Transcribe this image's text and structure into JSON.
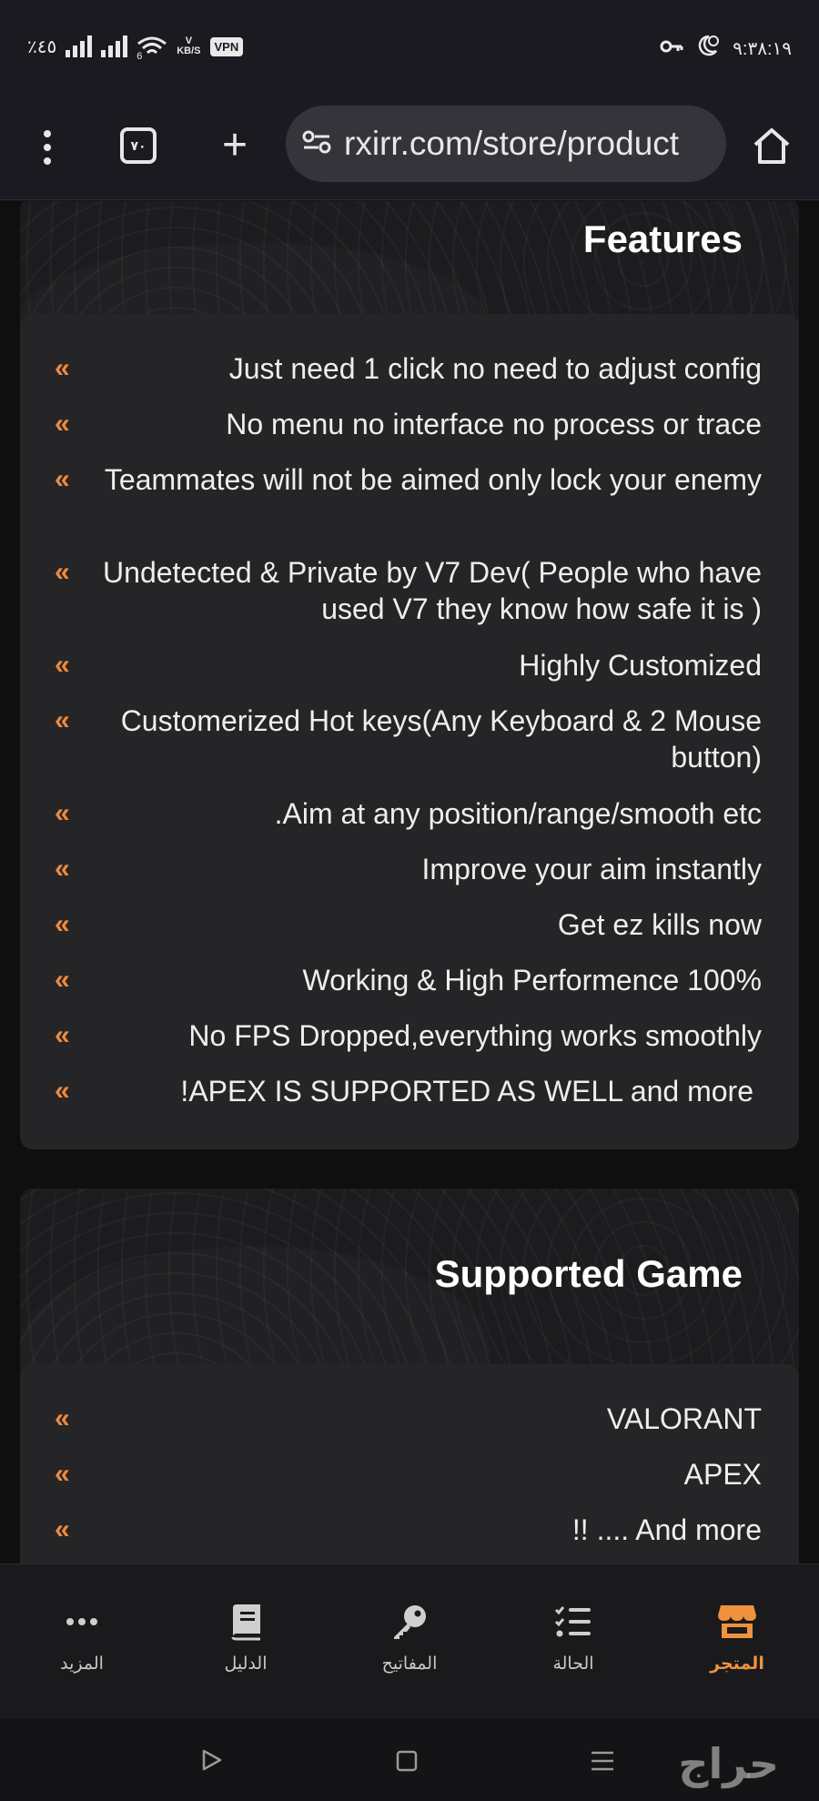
{
  "status_bar": {
    "battery": "٪٤٥",
    "network_speed_top": "V",
    "network_speed_bottom": "KB/S",
    "vpn": "VPN",
    "wifi_gen": "6",
    "time": "٩:٣٨:١٩"
  },
  "browser": {
    "tab_count": "٧٠",
    "url": "rxirr.com/store/product"
  },
  "features": {
    "title": "Features",
    "items": [
      "Just need 1 click no need to adjust config",
      "No menu no interface no process or trace",
      "Teammates will not be aimed only lock your enemy",
      "Undetected & Private by V7 Dev( People who have used V7 they know how safe it is )",
      "Highly Customized",
      "Customerized Hot keys(Any Keyboard & 2 Mouse button)",
      ".Aim at any position/range/smooth etc",
      "Improve your aim instantly",
      "Get ez kills now",
      "Working & High Performence 100%",
      "No FPS Dropped,everything works smoothly",
      "!APEX IS SUPPORTED AS WELL and more"
    ]
  },
  "supported": {
    "title": "Supported Game",
    "items": [
      "VALORANT",
      "APEX",
      "!! .... And more"
    ]
  },
  "bullet": "«",
  "bottom_nav": {
    "more": "المزيد",
    "guide": "الدليل",
    "keys": "المفاتيح",
    "status": "الحالة",
    "store": "المتجر"
  },
  "watermark": "حراج",
  "colors": {
    "accent": "#f0913d",
    "card": "#252528",
    "background": "#0f0f10"
  }
}
